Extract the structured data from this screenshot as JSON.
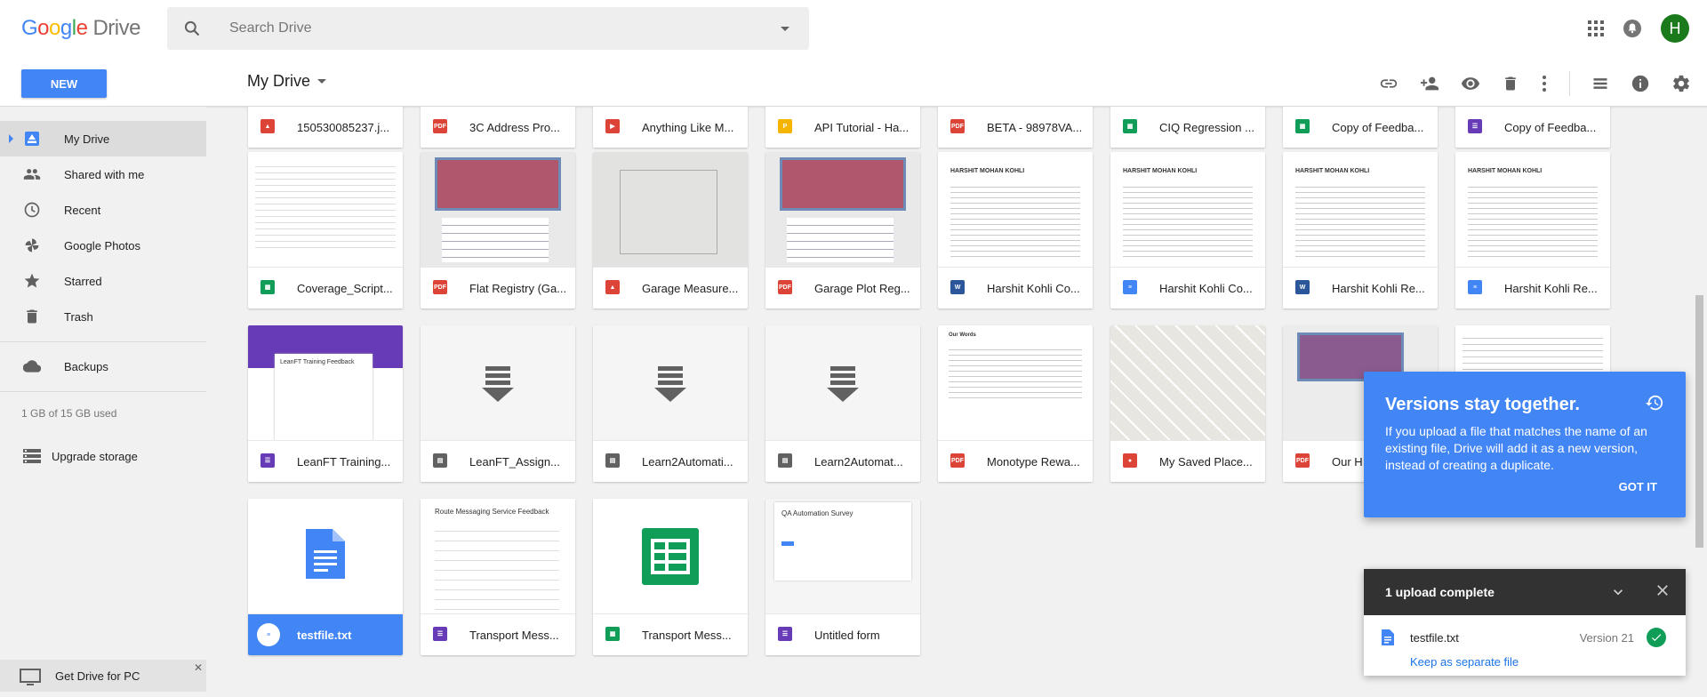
{
  "header": {
    "logo_google": "Google",
    "logo_drive": "Drive",
    "search_placeholder": "Search Drive",
    "avatar_letter": "H"
  },
  "toolbar": {
    "new_label": "NEW",
    "breadcrumb": "My Drive"
  },
  "sidebar": {
    "items": [
      {
        "label": "My Drive",
        "icon": "drive-icon"
      },
      {
        "label": "Shared with me",
        "icon": "people-icon"
      },
      {
        "label": "Recent",
        "icon": "clock-icon"
      },
      {
        "label": "Google Photos",
        "icon": "photos-icon"
      },
      {
        "label": "Starred",
        "icon": "star-icon"
      },
      {
        "label": "Trash",
        "icon": "trash-icon"
      },
      {
        "label": "Backups",
        "icon": "cloud-icon"
      }
    ],
    "storage": "1 GB of 15 GB used",
    "upgrade": "Upgrade storage",
    "get_drive": "Get Drive for PC"
  },
  "files": [
    {
      "name": "150530085237.j...",
      "type": "image"
    },
    {
      "name": "3C Address Pro...",
      "type": "pdf"
    },
    {
      "name": "Anything Like M...",
      "type": "video"
    },
    {
      "name": "API Tutorial - Ha...",
      "type": "slides"
    },
    {
      "name": "BETA - 98978VA...",
      "type": "pdf"
    },
    {
      "name": "CIQ Regression ...",
      "type": "sheet"
    },
    {
      "name": "Copy of Feedba...",
      "type": "sheet"
    },
    {
      "name": "Copy of Feedba...",
      "type": "form"
    },
    {
      "name": "Coverage_Script...",
      "type": "sheet"
    },
    {
      "name": "Flat Registry (Ga...",
      "type": "pdf"
    },
    {
      "name": "Garage Measure...",
      "type": "image"
    },
    {
      "name": "Garage Plot Reg...",
      "type": "pdf"
    },
    {
      "name": "Harshit Kohli Co...",
      "type": "word"
    },
    {
      "name": "Harshit Kohli Co...",
      "type": "doc"
    },
    {
      "name": "Harshit Kohli Re...",
      "type": "word"
    },
    {
      "name": "Harshit Kohli Re...",
      "type": "doc"
    },
    {
      "name": "LeanFT Training...",
      "type": "form"
    },
    {
      "name": "LeanFT_Assign...",
      "type": "archive"
    },
    {
      "name": "Learn2Automati...",
      "type": "archive"
    },
    {
      "name": "Learn2Automat...",
      "type": "archive"
    },
    {
      "name": "Monotype Rewa...",
      "type": "pdf"
    },
    {
      "name": "My Saved Place...",
      "type": "map"
    },
    {
      "name": "Our H",
      "type": "pdf"
    },
    {
      "name": "",
      "type": "pdf"
    },
    {
      "name": "testfile.txt",
      "type": "txt"
    },
    {
      "name": "Transport Mess...",
      "type": "form"
    },
    {
      "name": "Transport Mess...",
      "type": "sheet"
    },
    {
      "name": "Untitled form",
      "type": "form"
    }
  ],
  "thumb_text": {
    "resume_name": "HARSHIT MOHAN KOHLI",
    "leanft_title": "LeanFT Training Feedback",
    "route_title": "Route Messaging Service Feedback",
    "qa_title": "QA Automation Survey",
    "our_words": "Our Words"
  },
  "tooltip": {
    "title": "Versions stay together.",
    "body": "If you upload a file that matches the name of an existing file, Drive will add it as a new version, instead of creating a duplicate.",
    "button": "GOT IT"
  },
  "upload": {
    "title": "1 upload complete",
    "file": "testfile.txt",
    "version": "Version 21",
    "keep": "Keep as separate file"
  },
  "colors": {
    "accent": "#4285f4",
    "pdf": "#db4437",
    "sheet": "#0f9d58",
    "form": "#673ab7",
    "slides": "#f4b400",
    "avatar": "#1b7a1b"
  }
}
